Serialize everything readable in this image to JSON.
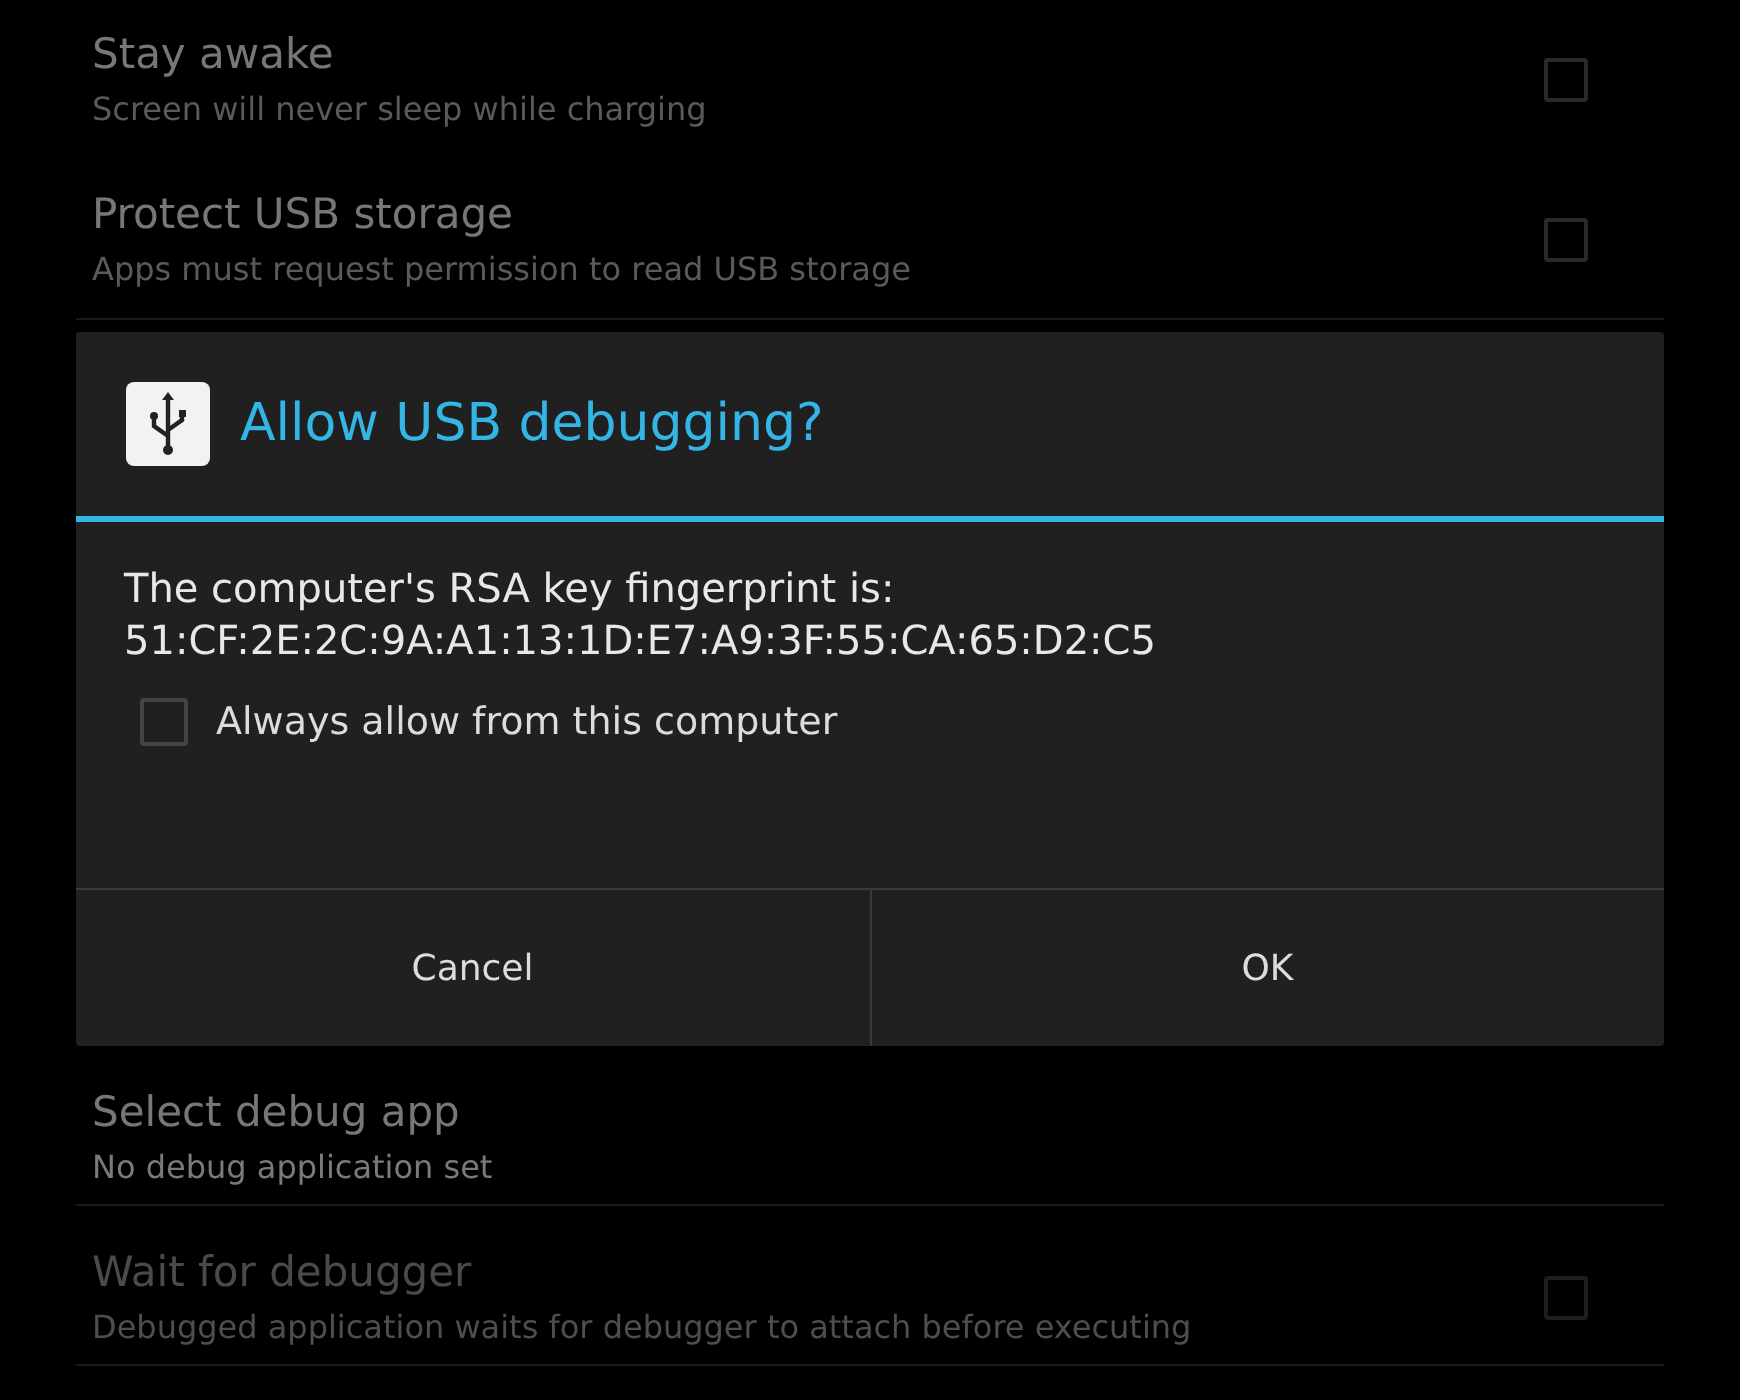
{
  "settings_top": [
    {
      "title": "Stay awake",
      "summary": "Screen will never sleep while charging",
      "disabled": false,
      "kind": "checkbox",
      "checked": false
    },
    {
      "title": "Protect USB storage",
      "summary": "Apps must request permission to read USB storage",
      "disabled": false,
      "kind": "checkbox",
      "checked": false
    }
  ],
  "dialog": {
    "title": "Allow USB debugging?",
    "message": "The computer's RSA key fingerprint is:",
    "fingerprint": "51:CF:2E:2C:9A:A1:13:1D:E7:A9:3F:55:CA:65:D2:C5",
    "checkbox": {
      "label": "Always allow from this computer",
      "checked": false
    },
    "buttons": [
      "Cancel",
      "OK"
    ]
  },
  "settings_bottom": [
    {
      "title": "Select debug app",
      "summary": "No debug application set",
      "disabled": false,
      "kind": "plain"
    },
    {
      "title": "Wait for debugger",
      "summary": "Debugged application waits for debugger to attach before executing",
      "disabled": true,
      "kind": "checkbox",
      "checked": false
    }
  ]
}
